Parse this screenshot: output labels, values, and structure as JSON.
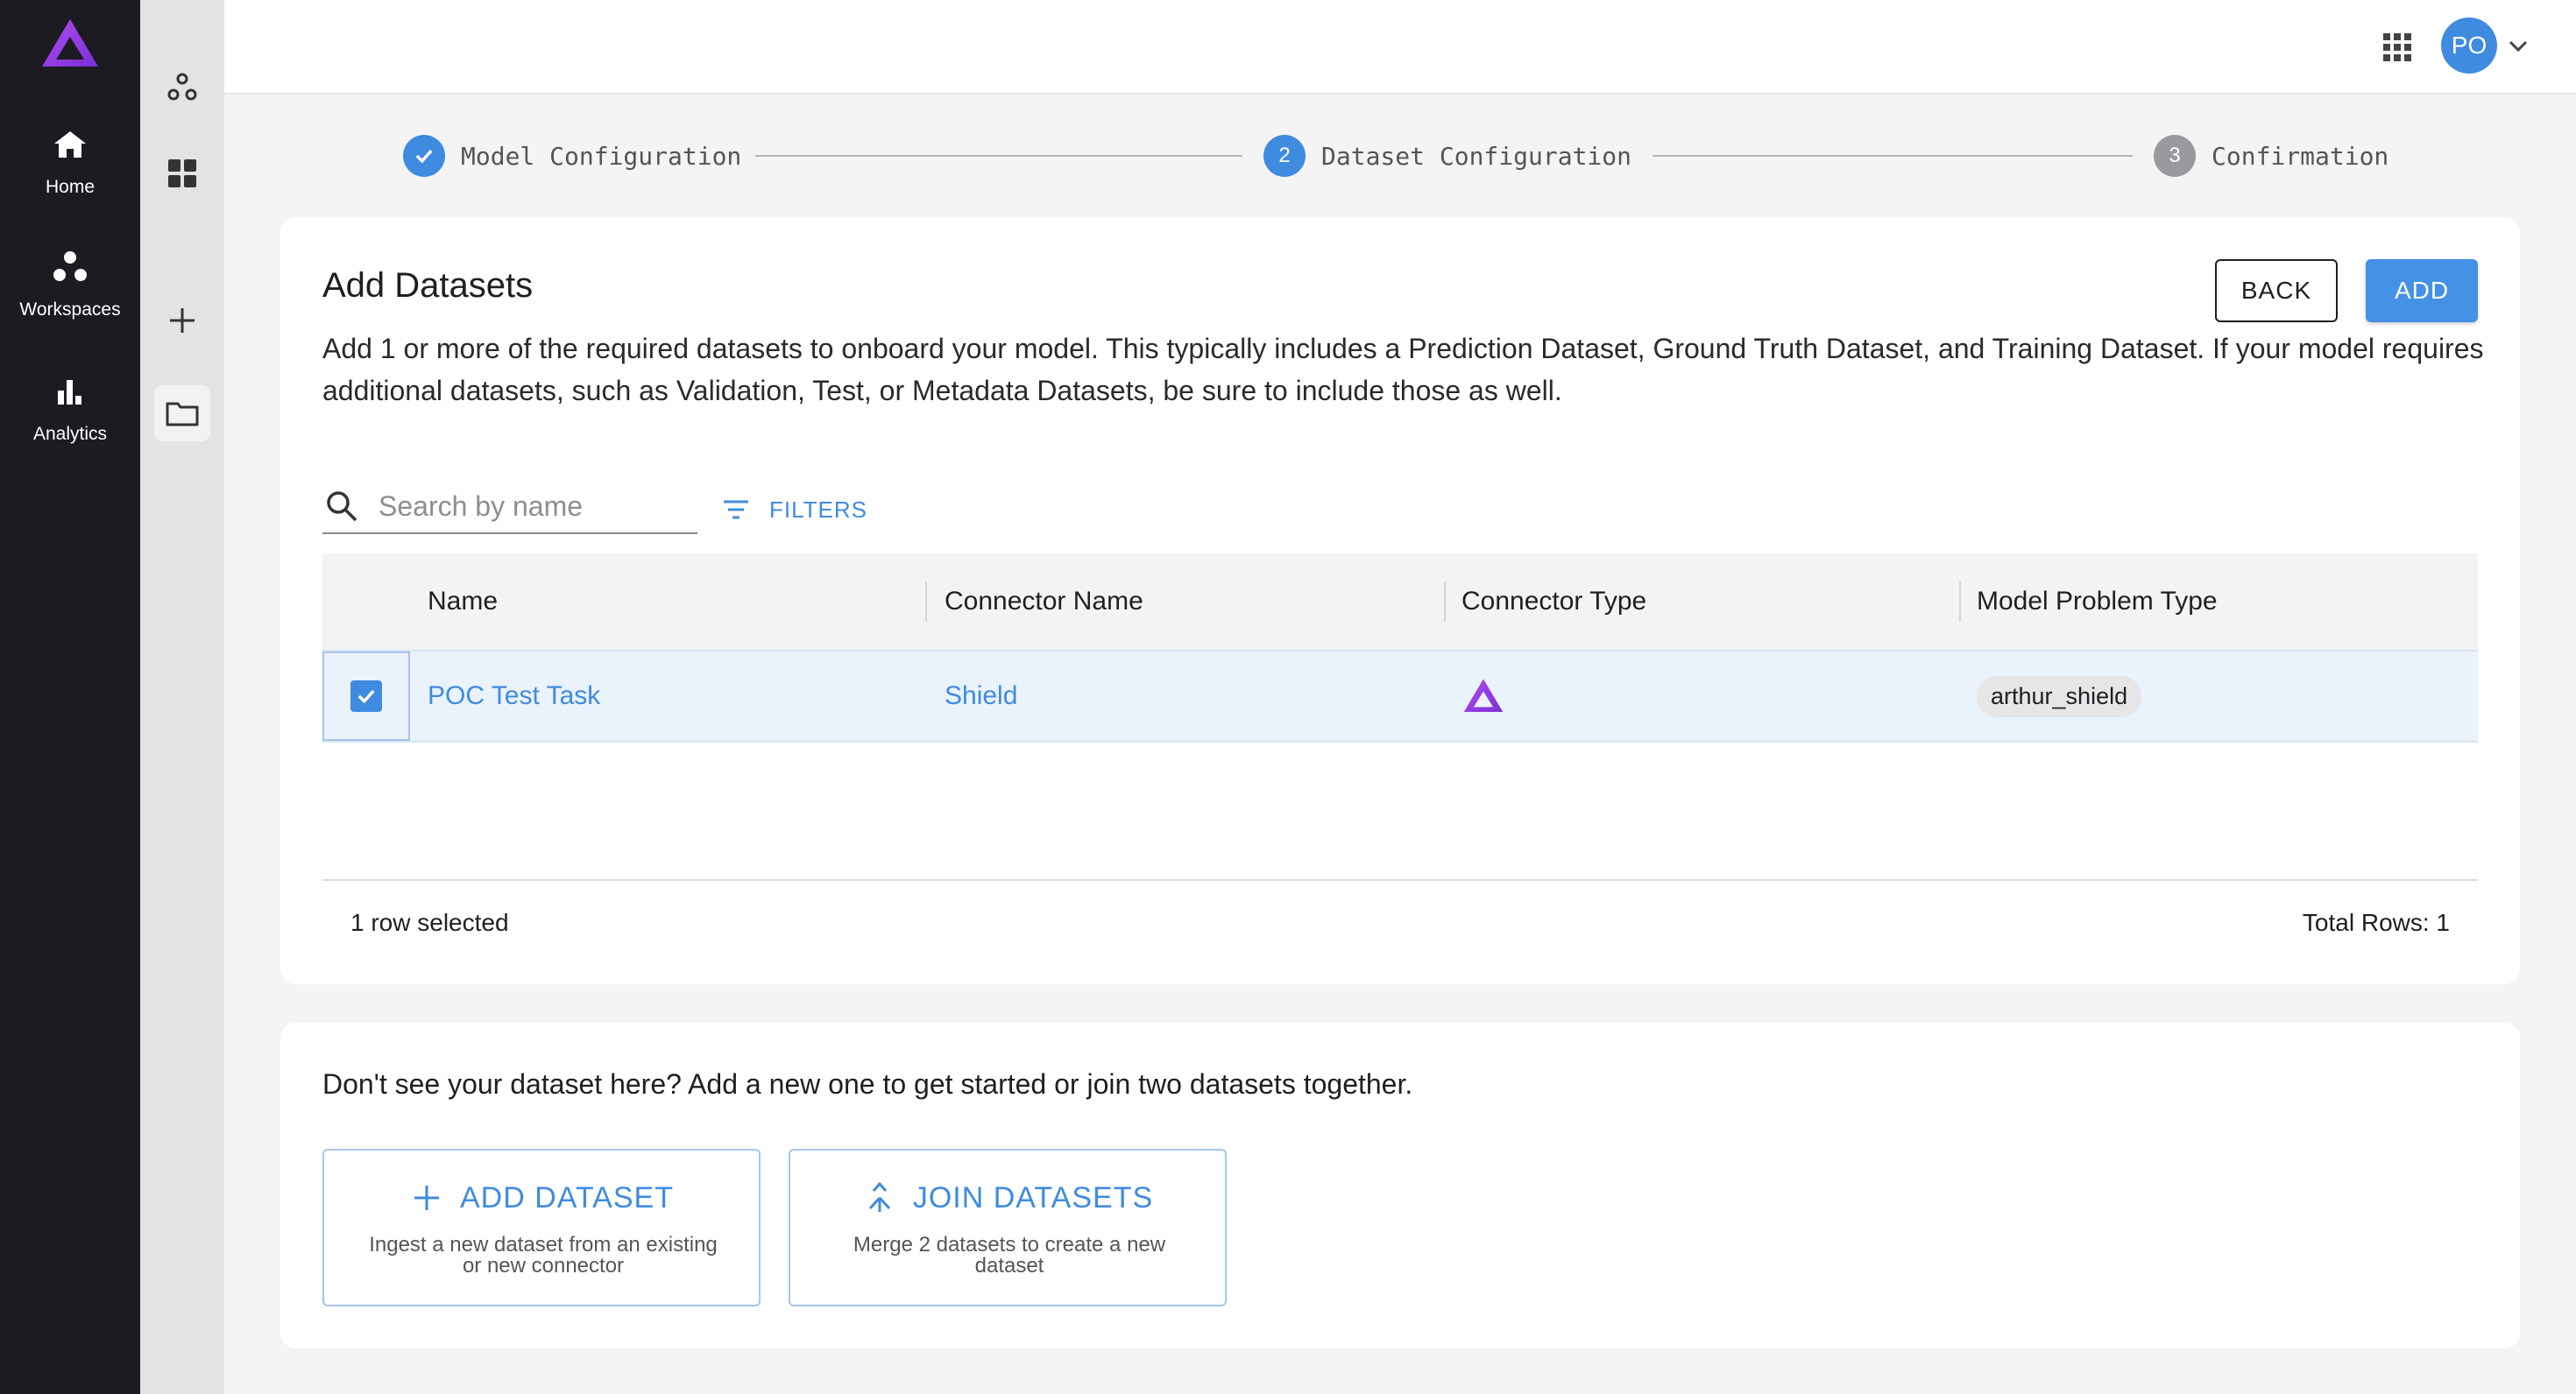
{
  "nav": {
    "items": [
      {
        "label": "Home",
        "icon": "home-icon"
      },
      {
        "label": "Workspaces",
        "icon": "workspaces-icon"
      },
      {
        "label": "Analytics",
        "icon": "analytics-icon"
      }
    ]
  },
  "header": {
    "avatar_initials": "PO"
  },
  "stepper": {
    "steps": [
      {
        "label": "Model Configuration",
        "status": "done",
        "number": ""
      },
      {
        "label": "Dataset Configuration",
        "status": "active",
        "number": "2"
      },
      {
        "label": "Confirmation",
        "status": "pending",
        "number": "3"
      }
    ]
  },
  "main": {
    "title": "Add Datasets",
    "description": "Add 1 or more of the required datasets to onboard your model. This typically includes a Prediction Dataset, Ground Truth Dataset, and Training Dataset. If your model requires additional datasets, such as Validation, Test, or Metadata Datasets, be sure to include those as well.",
    "back_label": "BACK",
    "add_label": "ADD",
    "search_placeholder": "Search by name",
    "filters_label": "FILTERS",
    "table": {
      "columns": [
        "Name",
        "Connector Name",
        "Connector Type",
        "Model Problem Type"
      ],
      "rows": [
        {
          "name": "POC Test Task",
          "connector_name": "Shield",
          "connector_type_icon": "arthur-logo-icon",
          "model_problem_type": "arthur_shield",
          "selected": true
        }
      ]
    },
    "rows_selected": "1 row selected",
    "total_rows": "Total Rows: 1"
  },
  "bottom": {
    "text": "Don't see your dataset here? Add a new one to get started or join two datasets together.",
    "add_dataset": {
      "label": "ADD DATASET",
      "sub": "Ingest a new dataset from an existing or new connector"
    },
    "join_datasets": {
      "label": "JOIN DATASETS",
      "sub": "Merge 2 datasets to create a new dataset"
    }
  },
  "colors": {
    "accent": "#3f8be0",
    "brand_purple": "#9b3fe0",
    "nav_bg": "#1d1b22"
  }
}
